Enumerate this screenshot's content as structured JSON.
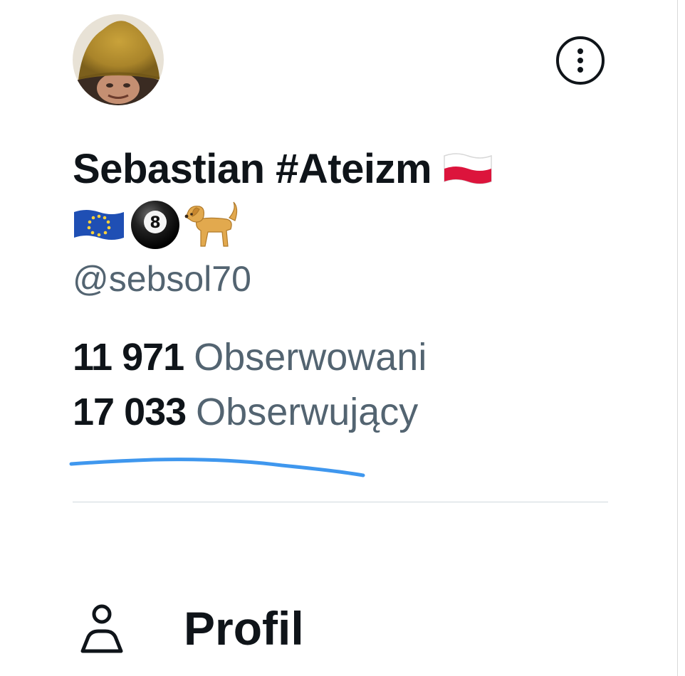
{
  "profile": {
    "display_name": "Sebastian #Ateizm",
    "handle": "@sebsol70",
    "emoji": [
      "flag-poland",
      "flag-eu",
      "billiard-8-ball",
      "dog"
    ]
  },
  "stats": {
    "following_count": "11 971",
    "following_label": "Obserwowani",
    "followers_count": "17 033",
    "followers_label": "Obserwujący"
  },
  "menu": {
    "profile_label": "Profil",
    "profile_icon": "person-icon"
  },
  "icons": {
    "more": "more-options-icon"
  },
  "colors": {
    "text_primary": "#0f1419",
    "text_secondary": "#536471",
    "annotation_blue": "#3f97ee",
    "divider": "#cfd9de"
  }
}
